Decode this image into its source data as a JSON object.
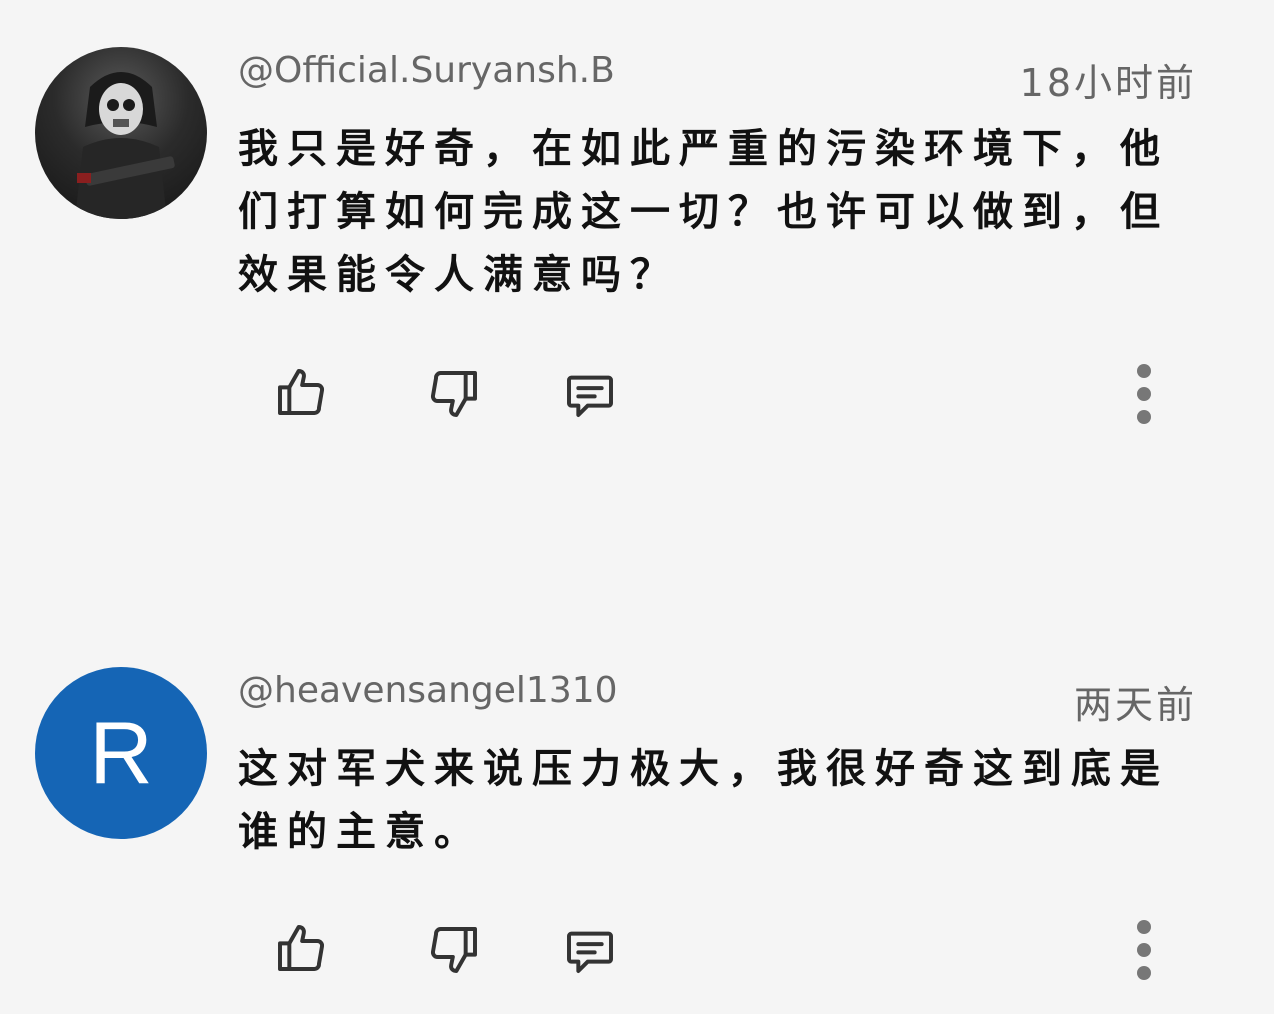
{
  "comments": [
    {
      "author": "@Official.Suryansh.B",
      "time": "18小时前",
      "text": "我只是好奇，在如此严重的污染环境下，他们打算如何完成这一切？也许可以做到，但效果能令人满意吗？",
      "avatar": {
        "type": "photo",
        "icon": "soldier-avatar-icon"
      }
    },
    {
      "author": "@heavensangel1310",
      "time": "两天前",
      "text": "这对军犬来说压力极大，我很好奇这到底是谁的主意。",
      "avatar": {
        "type": "letter",
        "letter": "R",
        "color": "#1565b5"
      }
    }
  ],
  "icons": {
    "like": "thumbs-up-icon",
    "dislike": "thumbs-down-icon",
    "reply": "reply-comment-icon",
    "more": "more-vertical-icon"
  }
}
